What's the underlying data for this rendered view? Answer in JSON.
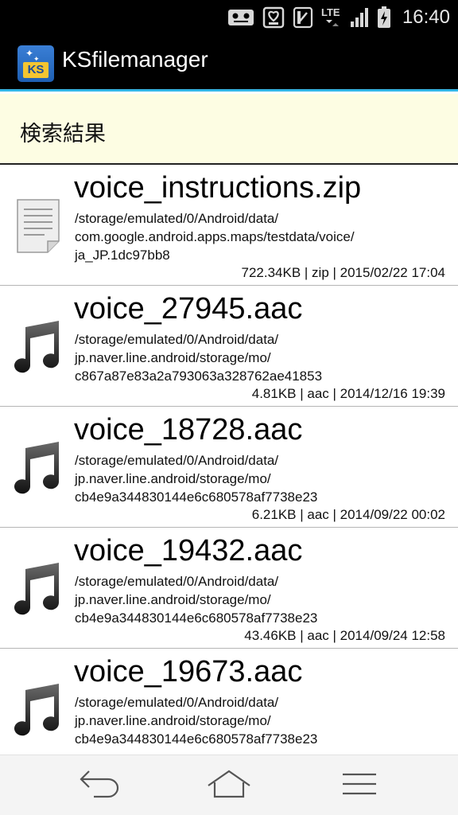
{
  "status_bar": {
    "time": "16:40",
    "network": "LTE",
    "icons": [
      "voicemail-icon",
      "signal-box-icon",
      "nfc-icon",
      "lte-icon",
      "signal-strength-icon",
      "battery-charging-icon"
    ]
  },
  "app_bar": {
    "title": "KSfilemanager",
    "icon_text": "KS"
  },
  "header": {
    "title": "検索結果"
  },
  "files": [
    {
      "name": "voice_instructions.zip",
      "icon": "document-icon",
      "path_lines": [
        "/storage/emulated/0/Android/data/",
        "com.google.android.apps.maps/testdata/voice/",
        "ja_JP.1dc97bb8"
      ],
      "meta": "722.34KB | zip | 2015/02/22 17:04"
    },
    {
      "name": "voice_27945.aac",
      "icon": "music-note-icon",
      "path_lines": [
        "/storage/emulated/0/Android/data/",
        "jp.naver.line.android/storage/mo/",
        "c867a87e83a2a793063a328762ae41853"
      ],
      "meta": "4.81KB | aac | 2014/12/16 19:39"
    },
    {
      "name": "voice_18728.aac",
      "icon": "music-note-icon",
      "path_lines": [
        "/storage/emulated/0/Android/data/",
        "jp.naver.line.android/storage/mo/",
        "cb4e9a344830144e6c680578af7738e23"
      ],
      "meta": "6.21KB | aac | 2014/09/22 00:02"
    },
    {
      "name": "voice_19432.aac",
      "icon": "music-note-icon",
      "path_lines": [
        "/storage/emulated/0/Android/data/",
        "jp.naver.line.android/storage/mo/",
        "cb4e9a344830144e6c680578af7738e23"
      ],
      "meta": "43.46KB | aac | 2014/09/24 12:58"
    },
    {
      "name": "voice_19673.aac",
      "icon": "music-note-icon",
      "path_lines": [
        "/storage/emulated/0/Android/data/",
        "jp.naver.line.android/storage/mo/",
        "cb4e9a344830144e6c680578af7738e23"
      ],
      "meta": ""
    }
  ],
  "nav_bar": {
    "icons": [
      "back-icon",
      "home-icon",
      "menu-icon"
    ]
  }
}
